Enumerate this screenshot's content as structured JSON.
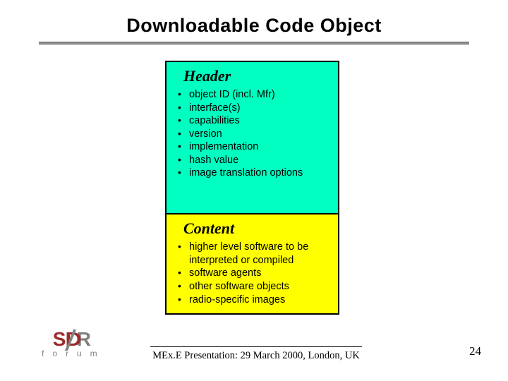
{
  "title": "Downloadable Code Object",
  "header_box": {
    "heading": "Header",
    "items": [
      "object ID (incl. Mfr)",
      "interface(s)",
      "capabilities",
      "version",
      "implementation",
      "hash value",
      "image translation options"
    ]
  },
  "content_box": {
    "heading": "Content",
    "items": [
      "higher level software to be interpreted or compiled",
      "software agents",
      "other software objects",
      "radio-specific images"
    ]
  },
  "logo": {
    "top_left": "S",
    "top_mid": "D",
    "top_right": "R",
    "bottom": "forum"
  },
  "footer": "MEx.E Presentation: 29 March 2000, London, UK",
  "page_number": "24"
}
